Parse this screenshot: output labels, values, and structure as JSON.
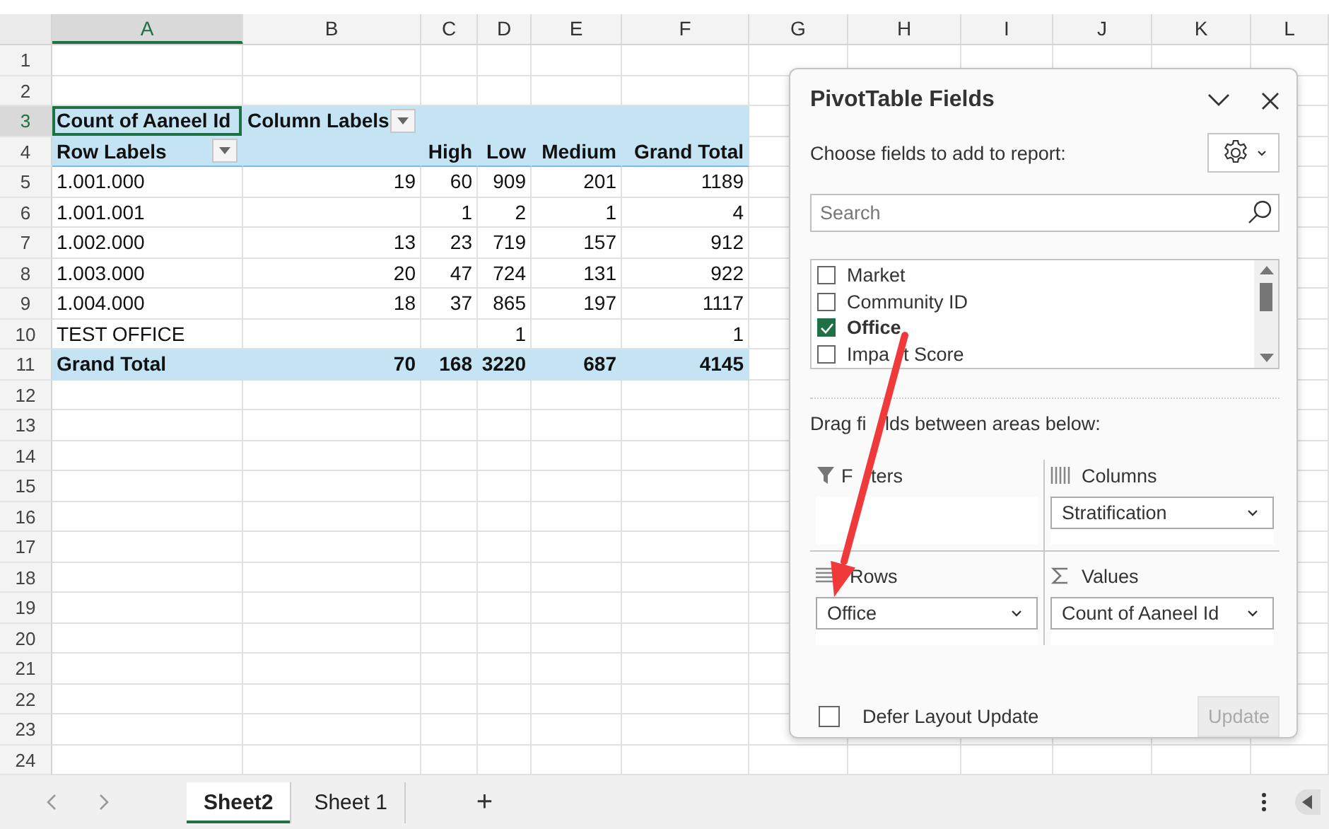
{
  "columns": [
    {
      "label": "A",
      "selected": true
    },
    {
      "label": "B",
      "selected": false
    },
    {
      "label": "C",
      "selected": false
    },
    {
      "label": "D",
      "selected": false
    },
    {
      "label": "E",
      "selected": false
    },
    {
      "label": "F",
      "selected": false
    },
    {
      "label": "G",
      "selected": false
    },
    {
      "label": "H",
      "selected": false
    },
    {
      "label": "I",
      "selected": false
    },
    {
      "label": "J",
      "selected": false
    },
    {
      "label": "K",
      "selected": false
    },
    {
      "label": "L",
      "selected": false
    }
  ],
  "row_numbers": [
    {
      "label": "1",
      "selected": false
    },
    {
      "label": "2",
      "selected": false
    },
    {
      "label": "3",
      "selected": true
    },
    {
      "label": "4",
      "selected": false
    },
    {
      "label": "5",
      "selected": false
    },
    {
      "label": "6",
      "selected": false
    },
    {
      "label": "7",
      "selected": false
    },
    {
      "label": "8",
      "selected": false
    },
    {
      "label": "9",
      "selected": false
    },
    {
      "label": "10",
      "selected": false
    },
    {
      "label": "11",
      "selected": false
    },
    {
      "label": "12",
      "selected": false
    },
    {
      "label": "13",
      "selected": false
    },
    {
      "label": "14",
      "selected": false
    },
    {
      "label": "15",
      "selected": false
    },
    {
      "label": "16",
      "selected": false
    },
    {
      "label": "17",
      "selected": false
    },
    {
      "label": "18",
      "selected": false
    },
    {
      "label": "19",
      "selected": false
    },
    {
      "label": "20",
      "selected": false
    },
    {
      "label": "21",
      "selected": false
    },
    {
      "label": "22",
      "selected": false
    },
    {
      "label": "23",
      "selected": false
    },
    {
      "label": "24",
      "selected": false
    }
  ],
  "pivot": {
    "value_field": "Count of Aaneel Id",
    "column_labels": "Column Labels",
    "row_labels": "Row Labels",
    "column_items": [
      "High",
      "Low",
      "Medium",
      "Grand Total"
    ],
    "rows": [
      {
        "label": "1.001.000",
        "values": {
          "blank": "19",
          "high": "60",
          "low": "909",
          "medium": "201",
          "grand_total": "1189"
        }
      },
      {
        "label": "1.001.001",
        "values": {
          "high": "1",
          "low": "2",
          "medium": "1",
          "grand_total": "4"
        }
      },
      {
        "label": "1.002.000",
        "values": {
          "blank": "13",
          "high": "23",
          "low": "719",
          "medium": "157",
          "grand_total": "912"
        }
      },
      {
        "label": "1.003.000",
        "values": {
          "blank": "20",
          "high": "47",
          "low": "724",
          "medium": "131",
          "grand_total": "922"
        }
      },
      {
        "label": "1.004.000",
        "values": {
          "blank": "18",
          "high": "37",
          "low": "865",
          "medium": "197",
          "grand_total": "1117"
        }
      },
      {
        "label": "TEST OFFICE",
        "values": {
          "low": "1",
          "grand_total": "1"
        }
      }
    ],
    "grand_total": {
      "label": "Grand Total",
      "values": {
        "blank": "70",
        "high": "168",
        "low": "3220",
        "medium": "687",
        "grand_total": "4145"
      }
    }
  },
  "field_list": {
    "title": "PivotTable Fields",
    "prompt": "Choose fields to add to report:",
    "search": {
      "placeholder": "Search"
    },
    "fields": [
      {
        "label_parts": [
          "Market"
        ],
        "checked": false
      },
      {
        "label_parts": [
          "Community ID"
        ],
        "checked": false
      },
      {
        "label_parts": [
          "Office"
        ],
        "checked": true
      },
      {
        "label_parts": [
          "Impa",
          "t Score"
        ],
        "checked": false
      }
    ],
    "areas_prompt_parts": [
      "Drag fi",
      "lds between areas below:"
    ],
    "areas": [
      {
        "kind": "filters",
        "label_parts": [
          "F",
          "ters"
        ]
      },
      {
        "kind": "columns",
        "label_parts": [
          "Columns"
        ],
        "items": [
          "Stratification"
        ]
      },
      {
        "kind": "rows",
        "label_parts": [
          "Rows"
        ],
        "items": [
          "Office"
        ]
      },
      {
        "kind": "values",
        "label_parts": [
          "Values"
        ],
        "items": [
          "Count of Aaneel Id"
        ]
      }
    ],
    "defer": {
      "label": "Defer Layout Update",
      "checked": false
    },
    "update_button": {
      "label": "Update",
      "disabled": true
    }
  },
  "sheet_tabs": [
    {
      "label": "Sheet2",
      "selected": true
    },
    {
      "label": "Sheet 1",
      "selected": false
    }
  ],
  "add_sheet": "+"
}
